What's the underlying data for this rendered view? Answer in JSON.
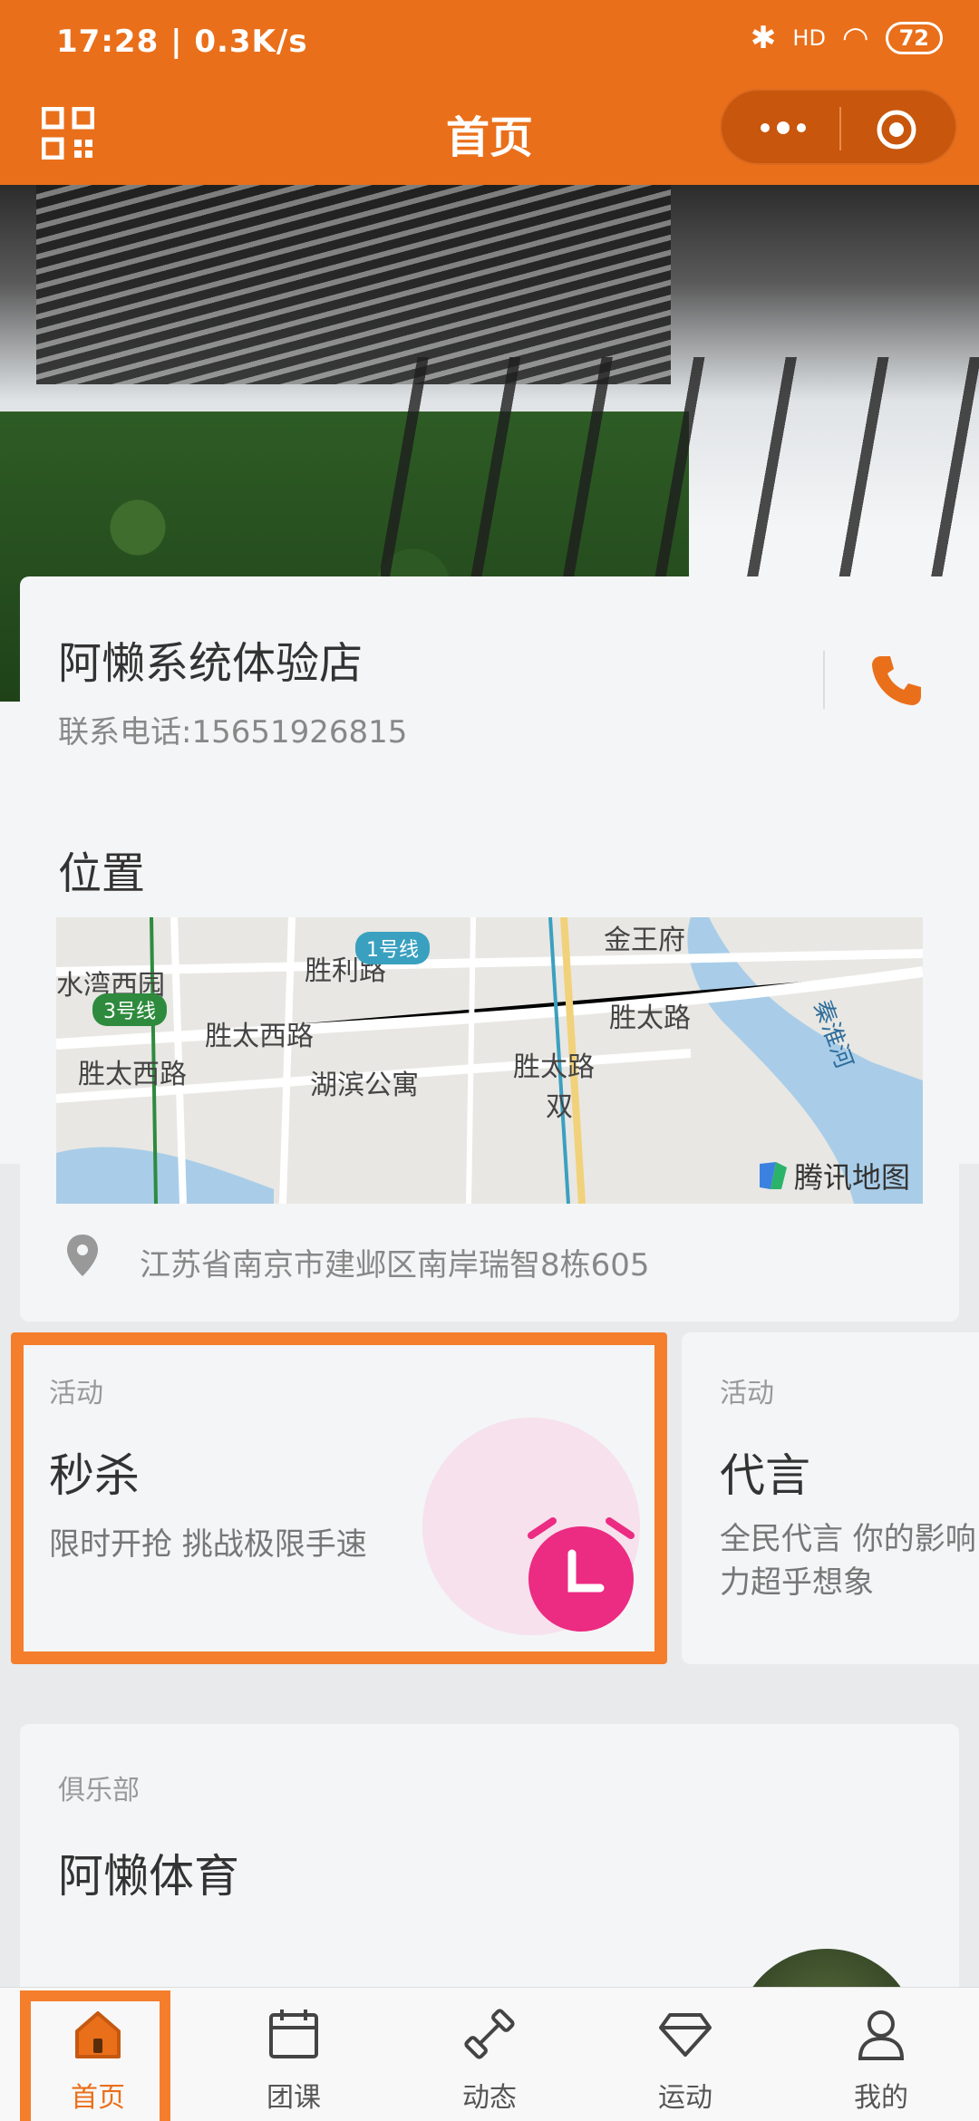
{
  "status_bar": {
    "time": "17:28 | 0.3K/s",
    "battery": "72",
    "signal_label": "HD"
  },
  "nav": {
    "title": "首页"
  },
  "store": {
    "name": "阿懒系统体验店",
    "phone": "联系电话:15651926815"
  },
  "location": {
    "title": "位置",
    "address": "江苏省南京市建邺区南岸瑞智8栋605",
    "map": {
      "labels": [
        "金王府",
        "水湾西园",
        "胜利路",
        "胜太路",
        "胜太西路",
        "胜太西路",
        "湖滨公寓",
        "胜太路",
        "秦淮河",
        "双"
      ],
      "badges": [
        "1号线",
        "3号线"
      ],
      "provider": "腾讯地图"
    }
  },
  "activities": [
    {
      "tag": "活动",
      "title": "秒杀",
      "desc": "限时开抢 挑战极限手速"
    },
    {
      "tag": "活动",
      "title": "代言",
      "desc": "全民代言 你的影响力超乎想象"
    }
  ],
  "club": {
    "tag": "俱乐部",
    "title": "阿懒体育"
  },
  "tabs": [
    {
      "label": "首页",
      "icon": "home-icon"
    },
    {
      "label": "团课",
      "icon": "calendar-icon"
    },
    {
      "label": "动态",
      "icon": "dumbbell-icon"
    },
    {
      "label": "运动",
      "icon": "diamond-icon"
    },
    {
      "label": "我的",
      "icon": "user-icon"
    }
  ],
  "colors": {
    "brand": "#ea6f1a",
    "highlight": "#f47e2c",
    "clock": "#ec2b82"
  }
}
